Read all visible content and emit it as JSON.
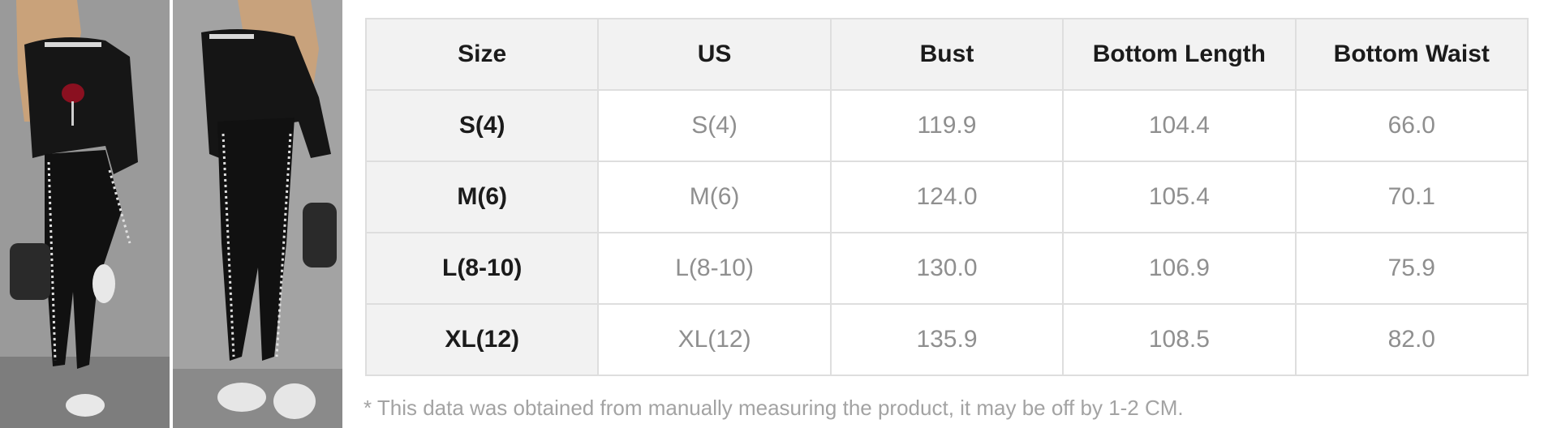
{
  "images": {
    "front_photo": "model-front-view",
    "back_photo": "model-back-view"
  },
  "table": {
    "headers": [
      "Size",
      "US",
      "Bust",
      "Bottom Length",
      "Bottom Waist"
    ],
    "rows": [
      [
        "S(4)",
        "S(4)",
        "119.9",
        "104.4",
        "66.0"
      ],
      [
        "M(6)",
        "M(6)",
        "124.0",
        "105.4",
        "70.1"
      ],
      [
        "L(8-10)",
        "L(8-10)",
        "130.0",
        "106.9",
        "75.9"
      ],
      [
        "XL(12)",
        "XL(12)",
        "135.9",
        "108.5",
        "82.0"
      ]
    ]
  },
  "footnote": "* This data was obtained from manually measuring the product, it may be off by 1-2 CM.",
  "colors": {
    "header_bg": "#f2f2f2",
    "border": "#dedede",
    "header_text": "#1b1b1b",
    "value_text": "#8f8f8f",
    "footnote_text": "#a3a3a3"
  }
}
